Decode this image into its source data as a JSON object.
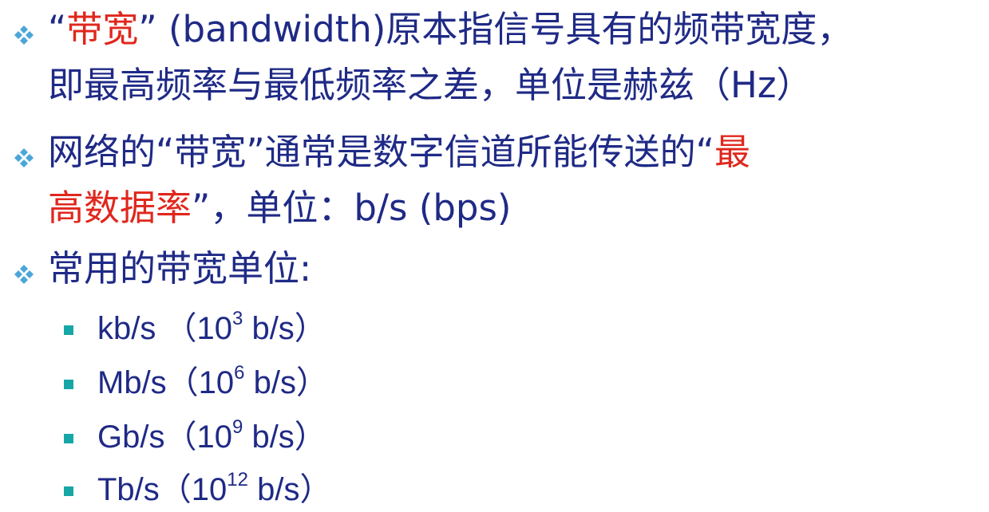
{
  "bullets": [
    {
      "line1": {
        "prefix_open": "“",
        "red_text": "带宽",
        "prefix_close": "”",
        "rest": " (bandwidth)原本指信号具有的频带宽度，"
      },
      "line2": "即最高频率与最低频率之差，单位是赫兹（Hz）"
    },
    {
      "line1": {
        "text": "网络的“带宽”通常是数字信道所能传送的“",
        "red_text": "最"
      },
      "line2": {
        "red_text": "高数据率",
        "rest": "”，单位：b/s (bps)"
      }
    },
    {
      "line1": "常用的带宽单位:"
    }
  ],
  "units": [
    {
      "unit": "kb/s （10",
      "exp": "3",
      "tail": " b/s）"
    },
    {
      "unit": "Mb/s（10",
      "exp": "6",
      "tail": " b/s）"
    },
    {
      "unit": "Gb/s（10",
      "exp": "9",
      "tail": " b/s）"
    },
    {
      "unit": "Tb/s（10",
      "exp": "12",
      "tail": " b/s）"
    }
  ],
  "colors": {
    "text": "#1f2a86",
    "highlight": "#e0271d",
    "diamond": "#4aa6d8",
    "square": "#17a6a6"
  }
}
